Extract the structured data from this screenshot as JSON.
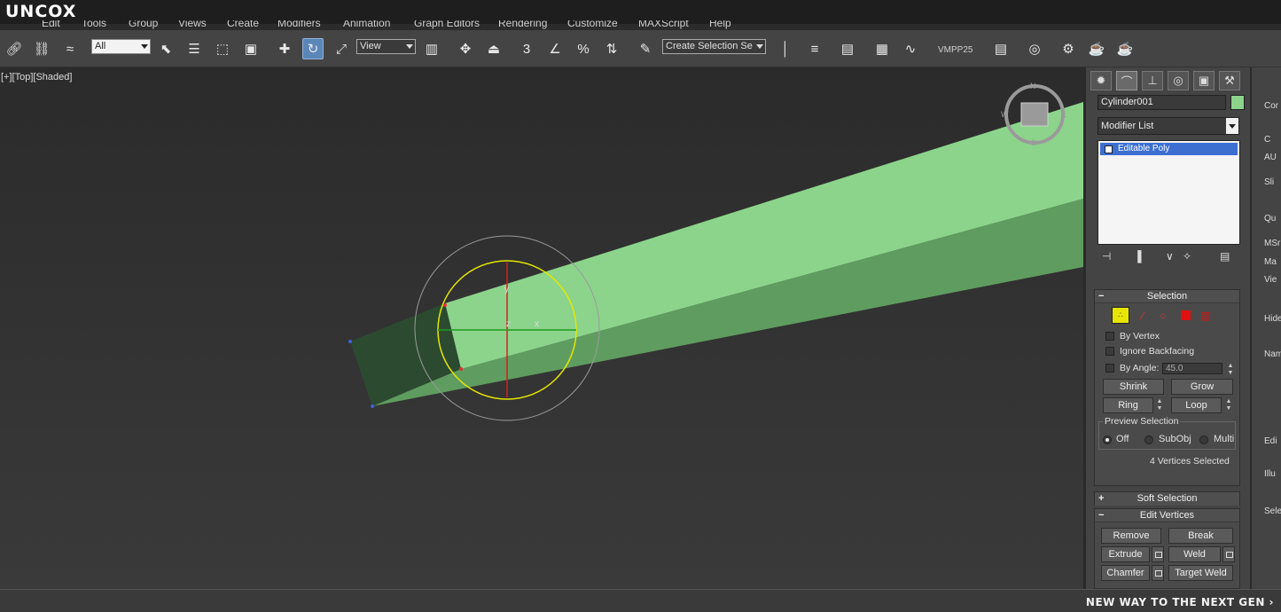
{
  "app": {
    "logo": "UNCOX",
    "footer": "NEW WAY TO THE NEXT GEN ›"
  },
  "menu": [
    "Edit",
    "Tools",
    "Group",
    "Views",
    "Create",
    "Modifiers",
    "Animation",
    "Graph Editors",
    "Rendering",
    "Customize",
    "MAXScript",
    "Help"
  ],
  "toolbar": {
    "selection_filter": "All",
    "ref_coord": "View",
    "named_selection": "Create Selection Se",
    "snap_3": "3",
    "percent": "%",
    "plugin_label": "VMPP25"
  },
  "viewport": {
    "label_plus": "[+]",
    "label_view": "[Top]",
    "label_shade": "[Shaded]",
    "viewcube_n": "N",
    "viewcube_s": "S",
    "viewcube_w": "W",
    "viewcube_e": "E",
    "axis_x": "x",
    "axis_y": "y",
    "axis_z": "z"
  },
  "command_panel": {
    "object_name": "Cylinder001",
    "object_color": "#8cd48c",
    "modifier_list": "Modifier List",
    "stack_item": "Editable Poly",
    "selection": {
      "title": "Selection",
      "by_vertex": "By Vertex",
      "ignore_backfacing": "Ignore Backfacing",
      "by_angle": "By Angle:",
      "angle_value": "45.0",
      "shrink": "Shrink",
      "grow": "Grow",
      "ring": "Ring",
      "loop": "Loop",
      "preview_title": "Preview Selection",
      "off": "Off",
      "subobj": "SubObj",
      "multi": "Multi",
      "status": "4 Vertices Selected"
    },
    "soft_selection": "Soft Selection",
    "edit_vertices": {
      "title": "Edit Vertices",
      "remove": "Remove",
      "break": "Break",
      "extrude": "Extrude",
      "weld": "Weld",
      "chamfer": "Chamfer",
      "target_weld": "Target Weld"
    }
  },
  "panel2": {
    "t1": "Cor",
    "t2": "C",
    "t3": "AU",
    "t4": "Sli",
    "t5": "Qu",
    "t6": "MSr",
    "t7": "Ma",
    "t8": "Vie",
    "t9": "Hide",
    "t10": "Nam",
    "t11": "Edi",
    "t12": "Illu",
    "t13": "Sele"
  },
  "colors": {
    "object_face": "#8cd48c",
    "object_side": "#5f9c5f",
    "selected_face": "#2c4a30",
    "stack_highlight": "#3d6fd1",
    "gizmo_yellow": "#e6e600"
  }
}
